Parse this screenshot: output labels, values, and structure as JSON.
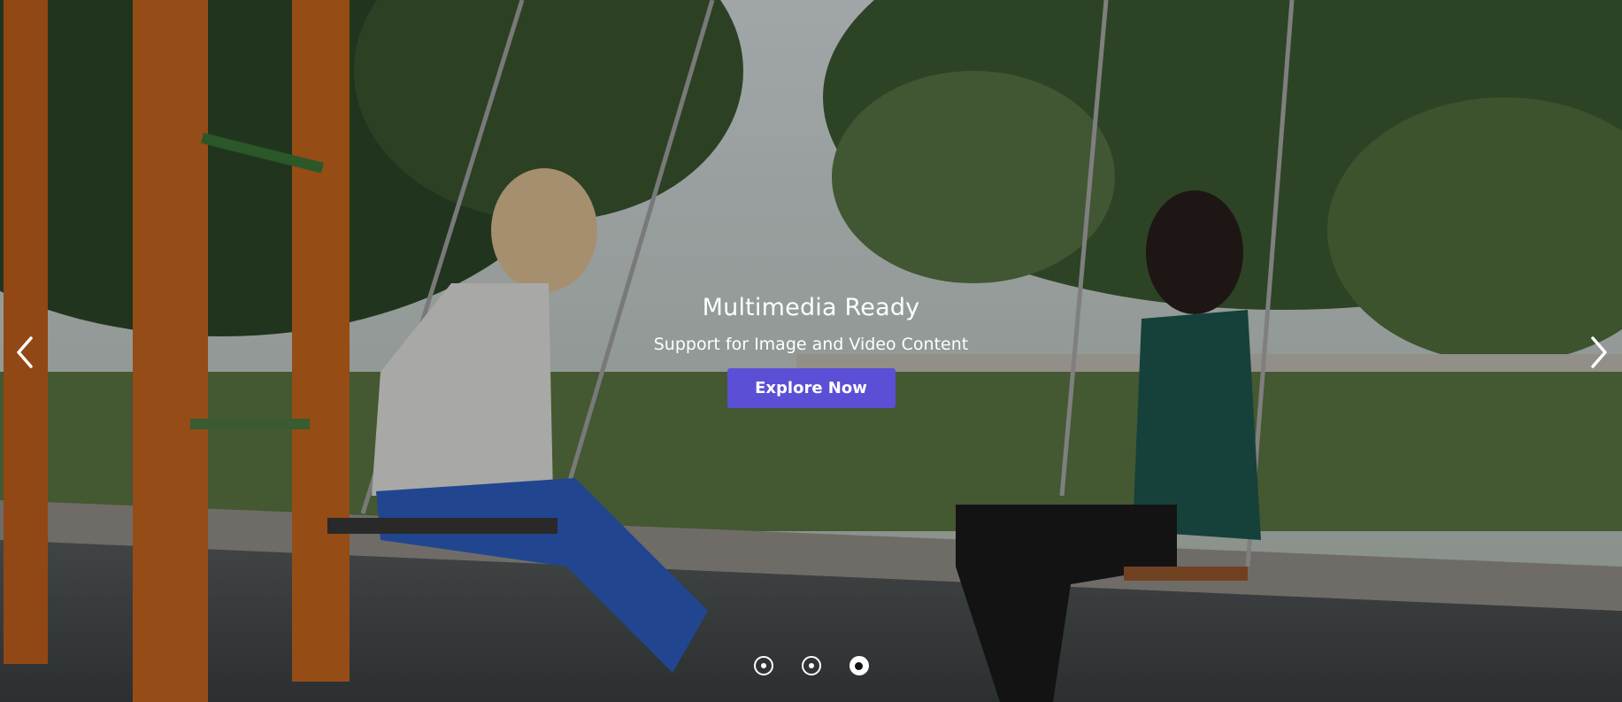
{
  "slide": {
    "title": "Multimedia Ready",
    "subtitle": "Support for Image and Video Content",
    "button_label": "Explore Now"
  },
  "navigation": {
    "prev_icon": "chevron-left-icon",
    "next_icon": "chevron-right-icon"
  },
  "pagination": {
    "total": 3,
    "active_index": 2
  },
  "colors": {
    "button": "#5b4fd6",
    "text": "#ffffff"
  }
}
